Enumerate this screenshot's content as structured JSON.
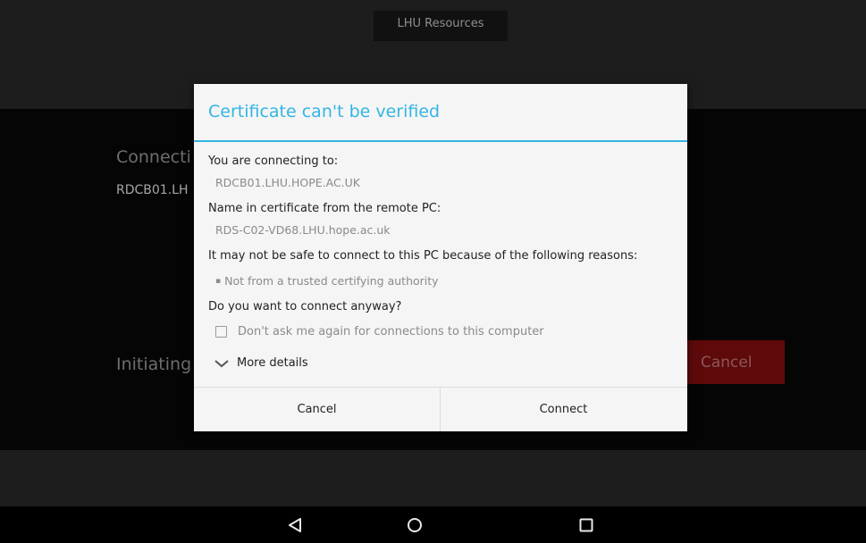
{
  "background_app": {
    "title": "LHU Resources",
    "status_text": "Connecti",
    "pc_name": "RDCB01.LH",
    "progress_text": "Initiating",
    "cancel_label": "Cancel"
  },
  "dialog": {
    "title": "Certificate can't be verified",
    "connecting_label": "You are connecting to:",
    "connecting_value": "RDCB01.LHU.HOPE.AC.UK",
    "cert_name_label": "Name in certificate from the remote PC:",
    "cert_name_value": "RDS-C02-VD68.LHU.hope.ac.uk",
    "reasons_label": "It may not be safe to connect to this PC because of the following reasons:",
    "reasons": [
      "Not from a trusted certifying authority"
    ],
    "question": "Do you want to connect anyway?",
    "dont_ask_label": "Don't ask me again for connections to this computer",
    "dont_ask_checked": false,
    "more_details_label": "More details",
    "cancel_label": "Cancel",
    "connect_label": "Connect"
  },
  "colors": {
    "accent": "#33b5e5",
    "danger": "#b71c1c"
  },
  "nav_bar": {
    "icons": [
      "back-icon",
      "home-icon",
      "recents-icon"
    ]
  }
}
